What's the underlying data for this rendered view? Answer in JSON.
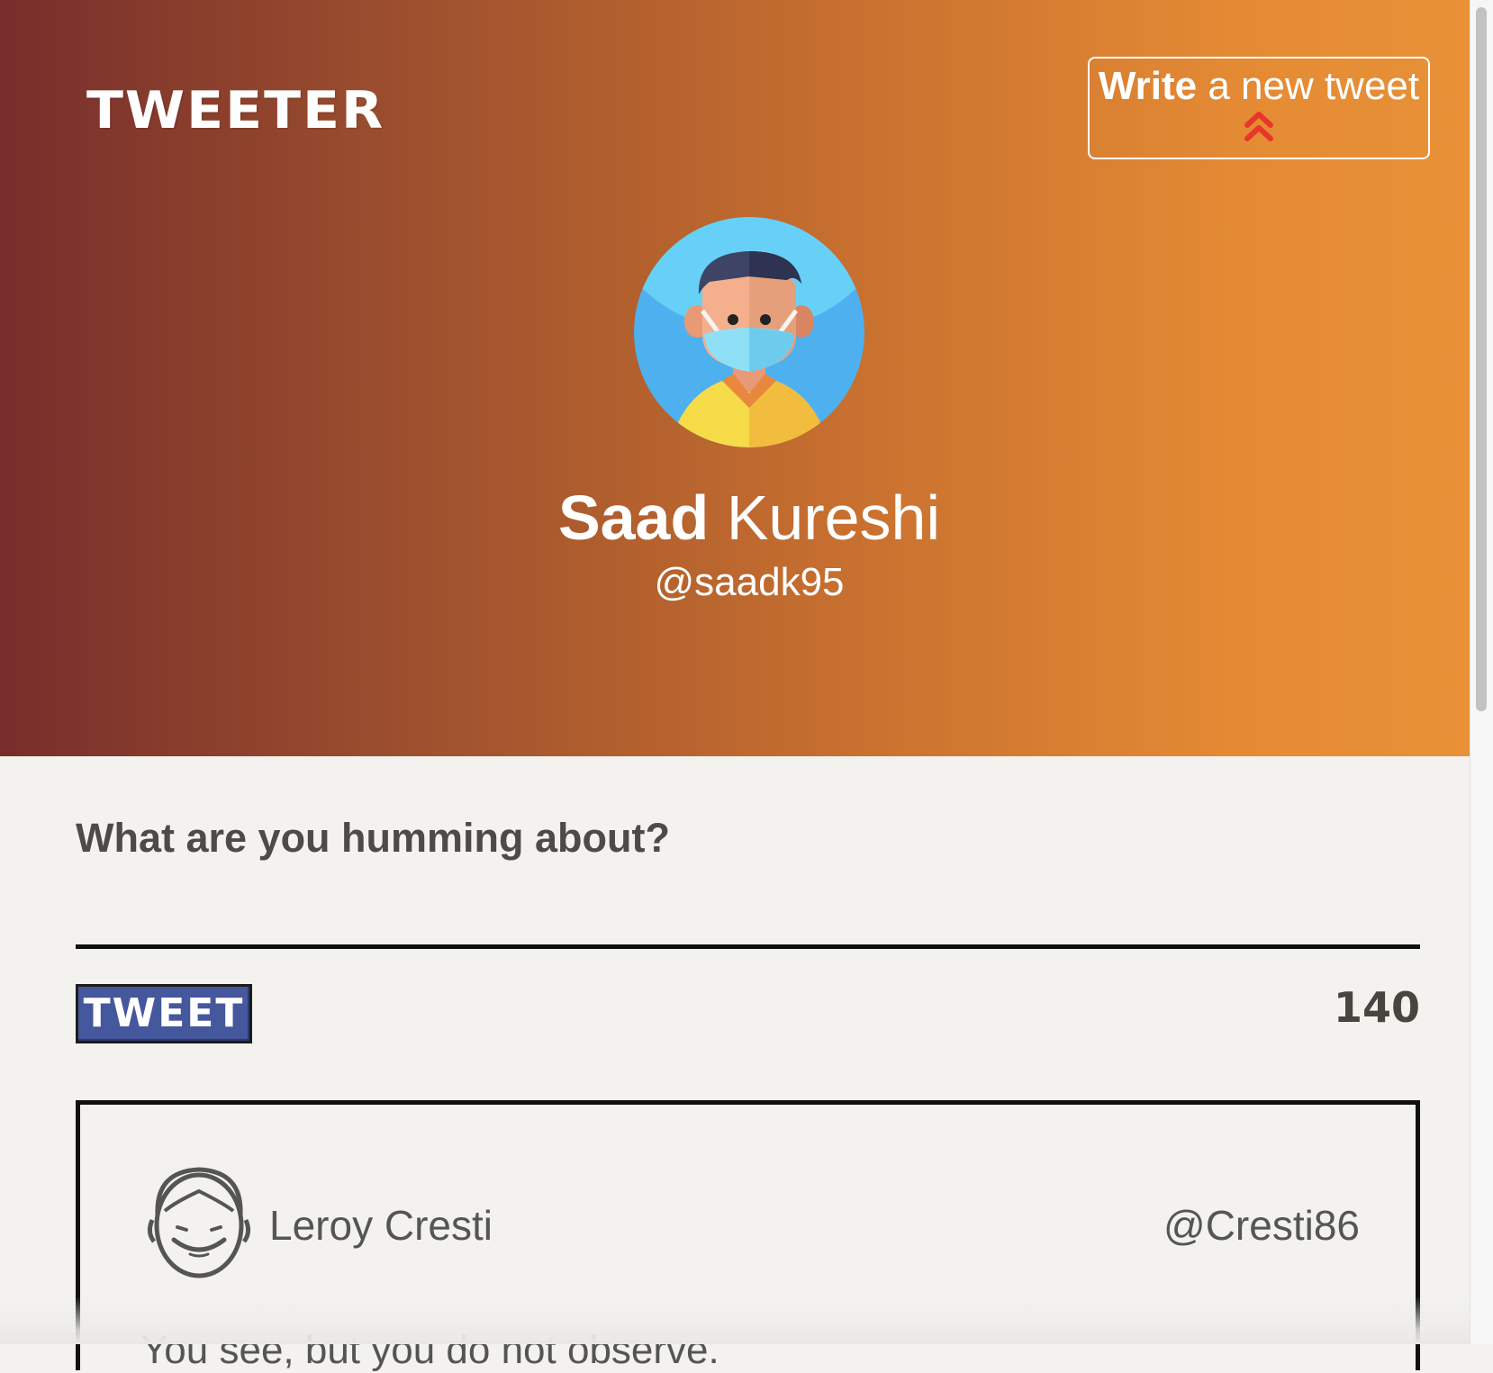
{
  "app": {
    "brand": "TWEETER"
  },
  "header": {
    "compose_strong": "Write",
    "compose_rest": " a new tweet",
    "compose_icon": "double-chevron-up-icon",
    "accent_color": "#e8362a"
  },
  "profile": {
    "first_name": "Saad",
    "last_name": " Kureshi",
    "handle": "@saadk95",
    "avatar_icon": "masked-person-avatar"
  },
  "composer": {
    "prompt": "What are you humming about?",
    "value": "",
    "button_label": "TWEET",
    "char_count": "140"
  },
  "tweets": [
    {
      "author": "Leroy Cresti",
      "handle": "@Cresti86",
      "text": "You see, but you do not observe."
    }
  ],
  "colors": {
    "gradient_start": "#772e2b",
    "gradient_end": "#e89137",
    "tweet_button": "#45579d",
    "background": "#f3f2ee"
  }
}
